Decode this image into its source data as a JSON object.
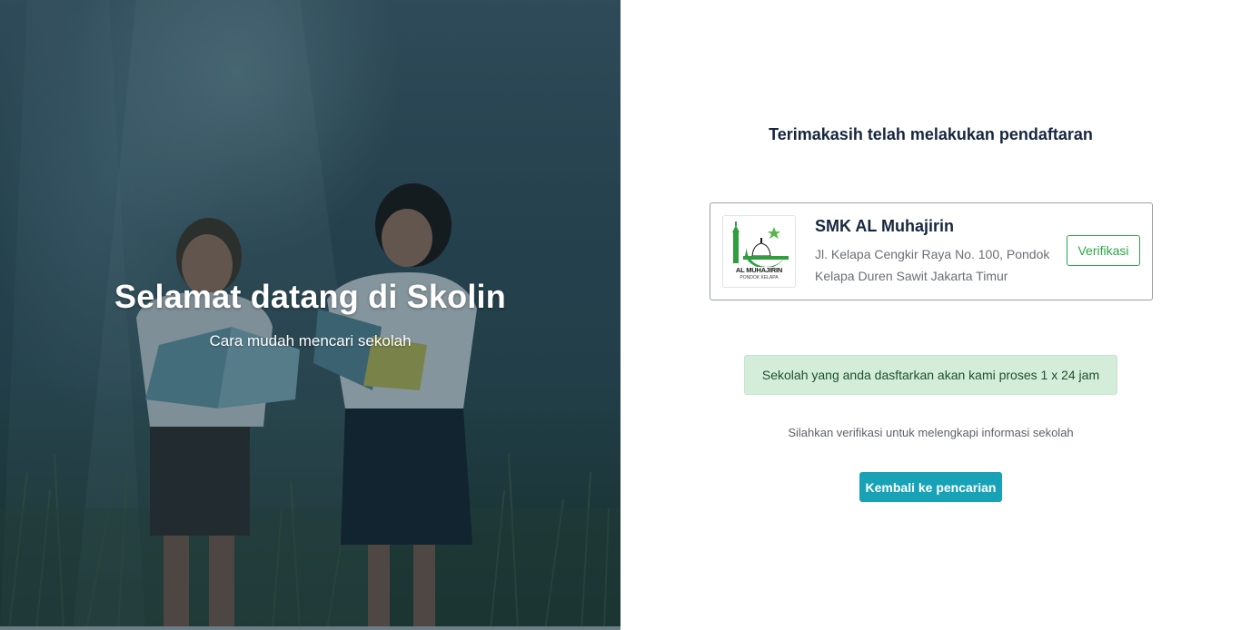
{
  "hero": {
    "title": "Selamat datang di Skolin",
    "subtitle": "Cara mudah mencari sekolah"
  },
  "main": {
    "heading": "Terimakasih telah melakukan pendaftaran",
    "school": {
      "name": "SMK AL Muhajirin",
      "address": "Jl. Kelapa Cengkir Raya No. 100, Pondok Kelapa Duren Sawit Jakarta Timur",
      "logo_text": "AL MUHAJIRIN",
      "logo_subtext": "PONDOK KELAPA",
      "verify_label": "Verifikasi"
    },
    "alert_message": "Sekolah yang anda dasftarkan akan kami proses 1 x 24 jam",
    "helper_text": "Silahkan verifikasi untuk melengkapi informasi sekolah",
    "back_button_label": "Kembali ke pencarian"
  },
  "colors": {
    "title_text": "#17263f",
    "verify_green": "#28a745",
    "alert_bg": "#d4edda",
    "alert_text": "#1d5129",
    "primary_button": "#17a2b8",
    "logo_green": "#2e9e3e"
  }
}
